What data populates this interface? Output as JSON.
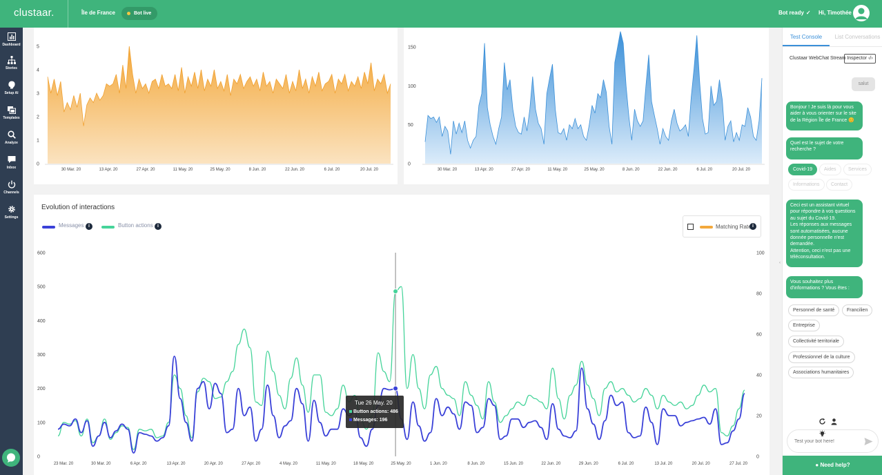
{
  "header": {
    "logo": "clustaar.",
    "project": "Île de France",
    "bot_status_badge": "Bot live",
    "bot_ready": "Bot ready",
    "greeting": "Hi, Timothée !"
  },
  "sidebar": {
    "items": [
      {
        "label": "Dashboard",
        "icon": "bar-chart-icon"
      },
      {
        "label": "Stories",
        "icon": "tree-icon"
      },
      {
        "label": "Setup AI",
        "icon": "brain-icon"
      },
      {
        "label": "Templates",
        "icon": "templates-icon"
      },
      {
        "label": "Analyze",
        "icon": "magnifier-icon"
      },
      {
        "label": "Inbox",
        "icon": "chat-bubble-icon"
      },
      {
        "label": "Channels",
        "icon": "power-icon"
      },
      {
        "label": "Settings",
        "icon": "gear-icon"
      }
    ]
  },
  "colors": {
    "brand_green": "#3fb47c",
    "sidebar": "#2f3e52",
    "orange": "#f3a83b",
    "blue": "#3a8fd8",
    "messages": "#3a41d8",
    "button_actions": "#46d49a"
  },
  "evolution": {
    "title": "Evolution of interactions",
    "legend_messages": "Messages",
    "legend_button_actions": "Button actions",
    "legend_matching_rate": "Matching Rate",
    "tooltip": {
      "date": "Tue 26 May. 20",
      "button_actions": "Button actions: 486",
      "messages": "Messages: 196"
    }
  },
  "chart_data": [
    {
      "type": "area",
      "title": "",
      "ylim": [
        0,
        5
      ],
      "yticks": [
        "0",
        "1",
        "2",
        "3",
        "4",
        "5"
      ],
      "x_tick_labels": [
        "30 Mar. 20",
        "13 Apr. 20",
        "27 Apr. 20",
        "11 May. 20",
        "25 May. 20",
        "8 Jun. 20",
        "22 Jun. 20",
        "6 Jul. 20",
        "20 Jul. 20"
      ],
      "values": [
        3.7,
        3.0,
        3.6,
        2.9,
        3.5,
        2.2,
        2.6,
        2.3,
        2.9,
        2.4,
        3.0,
        1.6,
        2.5,
        2.8,
        2.6,
        3.0,
        2.7,
        2.9,
        3.4,
        3.3,
        3.4,
        3.8,
        3.0,
        4.2,
        3.2,
        5.0,
        3.8,
        3.0,
        3.6,
        3.2,
        3.4,
        3.0,
        3.5,
        3.6,
        3.2,
        3.8,
        3.3,
        3.4,
        3.2,
        3.8,
        3.1,
        4.1,
        3.0,
        3.7,
        3.3,
        3.9,
        3.2,
        4.0,
        3.1,
        3.6,
        3.3,
        4.0,
        3.2,
        3.5,
        3.1,
        3.8,
        2.9,
        3.6,
        3.4,
        3.8,
        3.2,
        3.5,
        3.7,
        3.3,
        3.6,
        3.1,
        3.9,
        3.3,
        3.5,
        3.0,
        3.6,
        3.4,
        3.2,
        3.8,
        3.0,
        3.5,
        3.1,
        4.0,
        3.2,
        3.6,
        3.0,
        3.7,
        3.3,
        3.9,
        3.1,
        3.4,
        3.5,
        3.8,
        3.0,
        3.6,
        3.4,
        3.8,
        3.1,
        3.5,
        3.3,
        3.7,
        3.2,
        3.9,
        3.4,
        4.3,
        3.1,
        3.6,
        3.4,
        3.8,
        3.0,
        3.4
      ]
    },
    {
      "type": "area",
      "title": "",
      "ylim": [
        0,
        175
      ],
      "yticks": [
        "0",
        "50",
        "100",
        "150"
      ],
      "x_tick_labels": [
        "30 Mar. 20",
        "13 Apr. 20",
        "27 Apr. 20",
        "11 May. 20",
        "25 May. 20",
        "8 Jun. 20",
        "22 Jun. 20",
        "6 Jul. 20",
        "20 Jul. 20"
      ],
      "values": [
        28,
        62,
        58,
        60,
        53,
        60,
        35,
        48,
        42,
        12,
        55,
        38,
        52,
        40,
        55,
        30,
        20,
        30,
        35,
        75,
        90,
        155,
        72,
        50,
        35,
        25,
        45,
        60,
        130,
        95,
        108,
        70,
        48,
        40,
        38,
        60,
        42,
        70,
        112,
        70,
        52,
        45,
        25,
        90,
        110,
        128,
        70,
        40,
        38,
        45,
        30,
        50,
        45,
        58,
        45,
        50,
        35,
        30,
        50,
        75,
        65,
        90,
        85,
        108,
        92,
        48,
        25,
        130,
        150,
        170,
        155,
        100,
        60,
        30,
        70,
        55,
        48,
        55,
        100,
        140,
        80,
        62,
        45,
        25,
        45,
        35,
        30,
        55,
        70,
        52,
        42,
        45,
        50,
        35,
        85,
        122,
        165,
        105,
        58,
        38,
        40,
        100,
        75,
        80,
        108,
        82,
        30,
        48,
        55,
        28,
        40,
        30,
        50,
        48,
        72,
        60,
        35,
        30,
        55,
        110
      ]
    },
    {
      "type": "line",
      "title": "Evolution of interactions",
      "ylim": [
        0,
        600
      ],
      "y2lim": [
        0,
        100
      ],
      "yticks": [
        "0",
        "100",
        "200",
        "300",
        "400",
        "500",
        "600"
      ],
      "y2ticks": [
        "0",
        "20",
        "40",
        "60",
        "80",
        "100"
      ],
      "x_tick_labels": [
        "23 Mar. 20",
        "30 Mar. 20",
        "6 Apr. 20",
        "13 Apr. 20",
        "20 Apr. 20",
        "27 Apr. 20",
        "4 May. 20",
        "11 May. 20",
        "18 May. 20",
        "25 May. 20",
        "1 Jun. 20",
        "8 Jun. 20",
        "15 Jun. 20",
        "22 Jun. 20",
        "29 Jun. 20",
        "6 Jul. 20",
        "13 Jul. 20",
        "20 Jul. 20",
        "27 Jul. 20"
      ],
      "series": [
        {
          "name": "Messages",
          "values": [
            80,
            95,
            90,
            110,
            70,
            105,
            30,
            60,
            100,
            55,
            75,
            95,
            80,
            10,
            70,
            65,
            60,
            45,
            55,
            90,
            295,
            170,
            100,
            45,
            200,
            220,
            140,
            215,
            185,
            70,
            80,
            200,
            120,
            145,
            45,
            80,
            210,
            120,
            55,
            90,
            105,
            200,
            155,
            45,
            165,
            100,
            60,
            80,
            80,
            140,
            120,
            130,
            55,
            30,
            80,
            150,
            200,
            196,
            200,
            110,
            50,
            160,
            90,
            45,
            70,
            170,
            120,
            145,
            125,
            80,
            160,
            150,
            70,
            85,
            170,
            150,
            50,
            60,
            110,
            110,
            85,
            100,
            105,
            85,
            50,
            155,
            80,
            60,
            55,
            75,
            260,
            140,
            95,
            50,
            105,
            180,
            150,
            160,
            70,
            55,
            60,
            145,
            100,
            35,
            140,
            120,
            120,
            90,
            100,
            105,
            110,
            115,
            95,
            140,
            35,
            40,
            75,
            110,
            185
          ]
        },
        {
          "name": "Button actions",
          "values": [
            60,
            100,
            95,
            105,
            60,
            110,
            40,
            60,
            110,
            50,
            70,
            90,
            85,
            20,
            80,
            75,
            80,
            55,
            60,
            100,
            240,
            200,
            120,
            55,
            190,
            230,
            220,
            170,
            175,
            220,
            250,
            330,
            375,
            320,
            160,
            150,
            310,
            250,
            180,
            140,
            230,
            290,
            210,
            130,
            240,
            240,
            130,
            120,
            140,
            210,
            160,
            180,
            110,
            80,
            120,
            305,
            250,
            220,
            486,
            500,
            200,
            300,
            200,
            140,
            240,
            265,
            200,
            180,
            170,
            120,
            220,
            180,
            150,
            110,
            220,
            160,
            100,
            120,
            140,
            160,
            150,
            180,
            170,
            160,
            140,
            260,
            170,
            110,
            180,
            210,
            280,
            210,
            170,
            120,
            200,
            220,
            190,
            200,
            180,
            160,
            170,
            200,
            180,
            140,
            180,
            160,
            150,
            160,
            140,
            150,
            180,
            210,
            190,
            200,
            70,
            60,
            90,
            140,
            195
          ]
        }
      ]
    }
  ],
  "panel": {
    "tab_active": "Test Console",
    "tab_inactive": "List Conversations",
    "stream_label": "Clustaar WebChat Stream",
    "inspector_label": "Inspector",
    "user_message": "salut",
    "bot_messages": [
      "Bonjour ! Je suis là pour vous aider à vous orienter sur le site de la Région Île de France 😊",
      "Quel est le sujet de votre recherche ?",
      "Ceci est un assistant virtuel pour répondre à vos questions au sujet du Covid-19.\nLes réponses aux messages sont automatisées, aucune donnée personnelle n'est demandée.\nAttention, ceci n'est pas une téléconsultation.",
      "Vous souhaitez plus d'informations ? Vous êtes :"
    ],
    "topic_chips": [
      "Covid-19",
      "Aides",
      "Services",
      "Informations",
      "Contact"
    ],
    "profile_chips": [
      "Personnel de santé",
      "Francilien",
      "Entreprise",
      "Collectivité territoriale",
      "Professionnel de la culture",
      "Associations humanitaires"
    ],
    "input_placeholder": "Test your bot here!",
    "need_help": "Need help?"
  }
}
